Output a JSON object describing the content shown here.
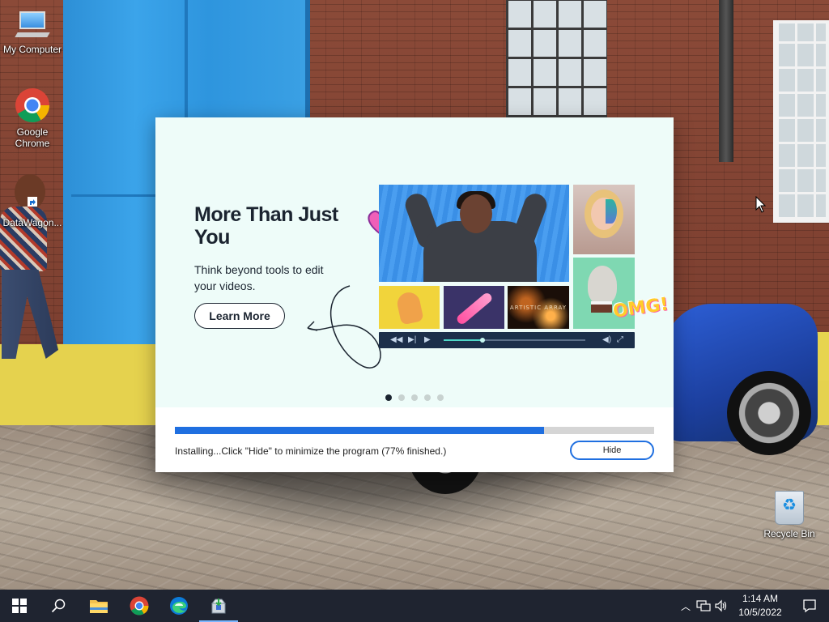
{
  "desktop": {
    "icons": [
      {
        "label": "My Computer"
      },
      {
        "label": "Google Chrome"
      },
      {
        "label": "DataWagon..."
      },
      {
        "label": "Recycle Bin"
      }
    ]
  },
  "installer": {
    "headline": "More Than Just You",
    "subtext": "Think beyond tools to edit your videos.",
    "learn_more_label": "Learn More",
    "tile_text": "ARTISTIC ARRAY",
    "sticker_text": "OMG!",
    "carousel": {
      "count": 5,
      "active_index": 0
    },
    "progress": {
      "fraction": 0.77,
      "fill_color": "#1f6fe0"
    },
    "status": "Installing...Click \"Hide\" to minimize the program (77% finished.)",
    "hide_label": "Hide"
  },
  "taskbar": {
    "apps": [
      {
        "name": "start-icon"
      },
      {
        "name": "search-icon"
      },
      {
        "name": "file-explorer-icon"
      },
      {
        "name": "chrome-icon"
      },
      {
        "name": "edge-icon"
      },
      {
        "name": "installer-app-icon",
        "active": true
      }
    ],
    "clock": {
      "time": "1:14 AM",
      "date": "10/5/2022"
    }
  }
}
